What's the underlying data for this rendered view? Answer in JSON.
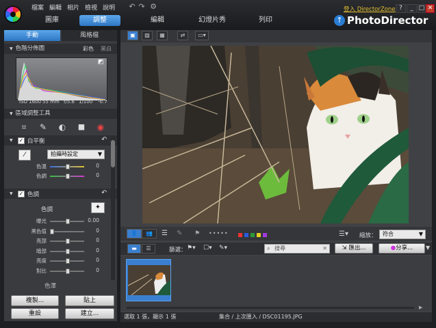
{
  "menu": [
    "檔案",
    "編輯",
    "相片",
    "檢視",
    "說明"
  ],
  "main_tabs": [
    "圖庫",
    "調整",
    "編輯",
    "幻燈片秀",
    "列印"
  ],
  "login_text": "登入 DirectorZone",
  "brand": "PhotoDirector",
  "window_buttons": [
    "?",
    "_",
    "□",
    "✕"
  ],
  "panel_tabs": {
    "manual": "手動",
    "style": "風格檔"
  },
  "histogram": {
    "title": "色階分佈圖",
    "color": "彩色",
    "bw": "黑白",
    "iso": "ISO 1600",
    "focal": "55 mm",
    "aperture": "f/5.6",
    "shutter": "1/100",
    "ev": "-0.7"
  },
  "regional": {
    "title": "區域調整工具",
    "tools": [
      "crop-icon",
      "brush-icon",
      "gradient-icon",
      "square-icon",
      "eye-icon"
    ]
  },
  "white_balance": {
    "title": "白平衡",
    "preset": "拍攝時設定",
    "sliders": [
      {
        "label": "色溫",
        "value": "0",
        "pos": 0.5
      },
      {
        "label": "色調",
        "value": "0",
        "pos": 0.5
      }
    ]
  },
  "tone": {
    "title": "色調",
    "sub": "色調",
    "sliders": [
      {
        "label": "曝光",
        "value": "0.00",
        "pos": 0.5
      },
      {
        "label": "黑色值",
        "value": "0",
        "pos": 0.0
      },
      {
        "label": "亮部",
        "value": "0",
        "pos": 0.5
      },
      {
        "label": "暗部",
        "value": "0",
        "pos": 0.5
      },
      {
        "label": "亮度",
        "value": "0",
        "pos": 0.5
      },
      {
        "label": "對比",
        "value": "0",
        "pos": 0.5
      }
    ],
    "more": "色澤"
  },
  "buttons": {
    "copy": "複製...",
    "paste": "貼上",
    "reset": "重設",
    "create": "建立..."
  },
  "zoom": {
    "label": "縮放：",
    "value": "符合"
  },
  "filter": {
    "label": "篩選：",
    "search_placeholder": "搜尋",
    "export": "匯出...",
    "share": "分享..."
  },
  "status": {
    "selection": "選取 1 張，顯示 1 張",
    "path": "集合 / 上次匯入 / DSC01195.JPG"
  },
  "colors": {
    "accent": "#3a7fd0",
    "brand_yellow": "#e7c233",
    "close_red": "#c23b2a"
  }
}
